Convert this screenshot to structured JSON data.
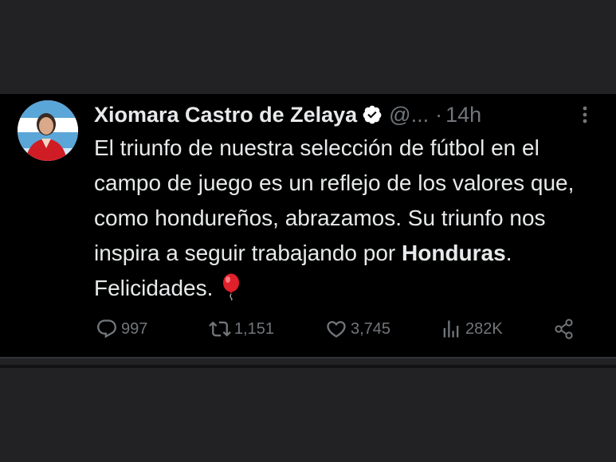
{
  "tweet": {
    "author_name": "Xiomara Castro de Zelaya",
    "handle": "@...",
    "separator": "·",
    "time": "14h",
    "text_part1": "El triunfo de nuestra selección de fútbol en el campo de juego es un reflejo de los valores que, como hondureños, abrazamos. Su triunfo nos inspira a seguir trabajando por ",
    "text_bold": "Honduras",
    "text_part2": ". Felicidades.",
    "emoji_icon": "red-balloon-icon"
  },
  "actions": {
    "replies": "997",
    "retweets": "1,151",
    "likes": "3,745",
    "views": "282K"
  },
  "colors": {
    "page_background": "#222225",
    "tweet_background": "#000000",
    "text": "#e7e9ea",
    "muted": "#71767b",
    "verified_badge": "#ffffff"
  }
}
